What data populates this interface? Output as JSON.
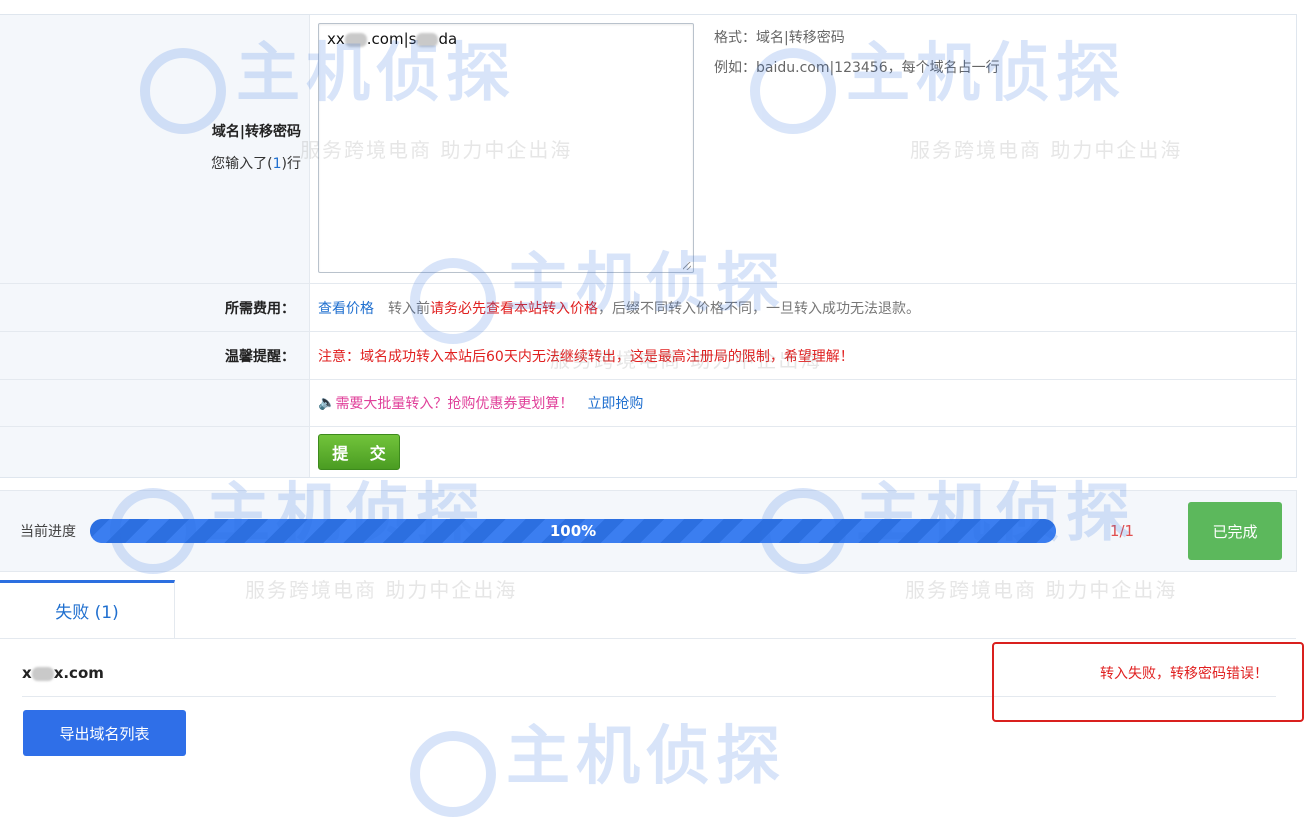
{
  "form": {
    "domain_label": "域名|转移密码",
    "lines_prefix": "您输入了(",
    "lines_count": "1",
    "lines_suffix": ")行",
    "textarea_value_start": "xx",
    "textarea_value_mid": ".com|s",
    "textarea_value_end": "da",
    "format_hint": "格式：域名|转移密码",
    "example_hint": "例如：baidu.com|123456，每个域名占一行",
    "fee_label": "所需费用：",
    "fee_link": "查看价格",
    "fee_note_pre": "转入前",
    "fee_note_red": "请务必先查看本站转入价格",
    "fee_note_post": "，后缀不同转入价格不同，一旦转入成功无法退款。",
    "tip_label": "温馨提醒：",
    "tip_text": "注意：域名成功转入本站后60天内无法继续转出，这是最高注册局的限制，希望理解！",
    "promo_icon": "speaker-icon",
    "promo_text": "需要大批量转入？抢购优惠券更划算！",
    "promo_link": "立即抢购",
    "submit_label": "提 交"
  },
  "progress": {
    "label": "当前进度",
    "percent_text": "100%",
    "percent_value": 1.0,
    "count": "1/1",
    "status_button": "已完成"
  },
  "results": {
    "tab_label": "失败 (1)",
    "rows": [
      {
        "domain_start": "x",
        "domain_end": "x.com",
        "message": "转入失败，转移密码错误！"
      }
    ],
    "export_button": "导出域名列表"
  },
  "watermark": {
    "brand": "主机侦探",
    "slogan": "服务跨境电商 助力中企出海"
  },
  "colors": {
    "accent": "#2c6fe0",
    "error": "#e02020",
    "success": "#5cb85c"
  }
}
